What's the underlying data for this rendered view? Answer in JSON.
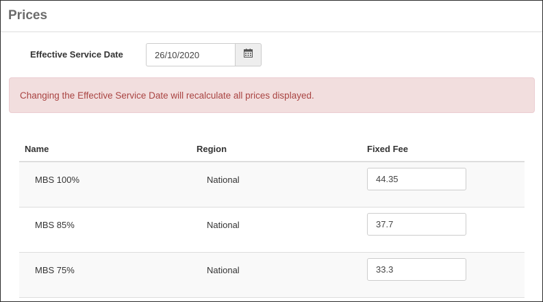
{
  "panel": {
    "title": "Prices"
  },
  "service_date": {
    "label": "Effective Service Date",
    "value": "26/10/2020",
    "button_icon": "calendar-icon"
  },
  "alert": {
    "text": "Changing the Effective Service Date will recalculate all prices displayed.",
    "background": "#f2dede",
    "color": "#a94442"
  },
  "table": {
    "columns": [
      "Name",
      "Region",
      "Fixed Fee"
    ],
    "rows": [
      {
        "name": "MBS 100%",
        "region": "National",
        "fixed_fee": "44.35"
      },
      {
        "name": "MBS 85%",
        "region": "National",
        "fixed_fee": "37.7"
      },
      {
        "name": "MBS 75%",
        "region": "National",
        "fixed_fee": "33.3"
      }
    ]
  }
}
